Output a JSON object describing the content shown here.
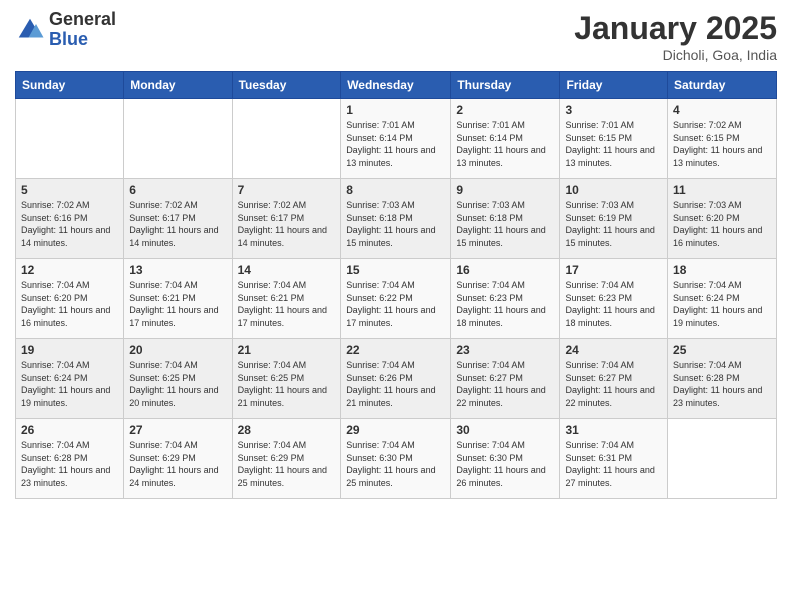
{
  "logo": {
    "general": "General",
    "blue": "Blue"
  },
  "title": "January 2025",
  "subtitle": "Dicholi, Goa, India",
  "weekdays": [
    "Sunday",
    "Monday",
    "Tuesday",
    "Wednesday",
    "Thursday",
    "Friday",
    "Saturday"
  ],
  "weeks": [
    [
      {
        "day": "",
        "sunrise": "",
        "sunset": "",
        "daylight": ""
      },
      {
        "day": "",
        "sunrise": "",
        "sunset": "",
        "daylight": ""
      },
      {
        "day": "",
        "sunrise": "",
        "sunset": "",
        "daylight": ""
      },
      {
        "day": "1",
        "sunrise": "Sunrise: 7:01 AM",
        "sunset": "Sunset: 6:14 PM",
        "daylight": "Daylight: 11 hours and 13 minutes."
      },
      {
        "day": "2",
        "sunrise": "Sunrise: 7:01 AM",
        "sunset": "Sunset: 6:14 PM",
        "daylight": "Daylight: 11 hours and 13 minutes."
      },
      {
        "day": "3",
        "sunrise": "Sunrise: 7:01 AM",
        "sunset": "Sunset: 6:15 PM",
        "daylight": "Daylight: 11 hours and 13 minutes."
      },
      {
        "day": "4",
        "sunrise": "Sunrise: 7:02 AM",
        "sunset": "Sunset: 6:15 PM",
        "daylight": "Daylight: 11 hours and 13 minutes."
      }
    ],
    [
      {
        "day": "5",
        "sunrise": "Sunrise: 7:02 AM",
        "sunset": "Sunset: 6:16 PM",
        "daylight": "Daylight: 11 hours and 14 minutes."
      },
      {
        "day": "6",
        "sunrise": "Sunrise: 7:02 AM",
        "sunset": "Sunset: 6:17 PM",
        "daylight": "Daylight: 11 hours and 14 minutes."
      },
      {
        "day": "7",
        "sunrise": "Sunrise: 7:02 AM",
        "sunset": "Sunset: 6:17 PM",
        "daylight": "Daylight: 11 hours and 14 minutes."
      },
      {
        "day": "8",
        "sunrise": "Sunrise: 7:03 AM",
        "sunset": "Sunset: 6:18 PM",
        "daylight": "Daylight: 11 hours and 15 minutes."
      },
      {
        "day": "9",
        "sunrise": "Sunrise: 7:03 AM",
        "sunset": "Sunset: 6:18 PM",
        "daylight": "Daylight: 11 hours and 15 minutes."
      },
      {
        "day": "10",
        "sunrise": "Sunrise: 7:03 AM",
        "sunset": "Sunset: 6:19 PM",
        "daylight": "Daylight: 11 hours and 15 minutes."
      },
      {
        "day": "11",
        "sunrise": "Sunrise: 7:03 AM",
        "sunset": "Sunset: 6:20 PM",
        "daylight": "Daylight: 11 hours and 16 minutes."
      }
    ],
    [
      {
        "day": "12",
        "sunrise": "Sunrise: 7:04 AM",
        "sunset": "Sunset: 6:20 PM",
        "daylight": "Daylight: 11 hours and 16 minutes."
      },
      {
        "day": "13",
        "sunrise": "Sunrise: 7:04 AM",
        "sunset": "Sunset: 6:21 PM",
        "daylight": "Daylight: 11 hours and 17 minutes."
      },
      {
        "day": "14",
        "sunrise": "Sunrise: 7:04 AM",
        "sunset": "Sunset: 6:21 PM",
        "daylight": "Daylight: 11 hours and 17 minutes."
      },
      {
        "day": "15",
        "sunrise": "Sunrise: 7:04 AM",
        "sunset": "Sunset: 6:22 PM",
        "daylight": "Daylight: 11 hours and 17 minutes."
      },
      {
        "day": "16",
        "sunrise": "Sunrise: 7:04 AM",
        "sunset": "Sunset: 6:23 PM",
        "daylight": "Daylight: 11 hours and 18 minutes."
      },
      {
        "day": "17",
        "sunrise": "Sunrise: 7:04 AM",
        "sunset": "Sunset: 6:23 PM",
        "daylight": "Daylight: 11 hours and 18 minutes."
      },
      {
        "day": "18",
        "sunrise": "Sunrise: 7:04 AM",
        "sunset": "Sunset: 6:24 PM",
        "daylight": "Daylight: 11 hours and 19 minutes."
      }
    ],
    [
      {
        "day": "19",
        "sunrise": "Sunrise: 7:04 AM",
        "sunset": "Sunset: 6:24 PM",
        "daylight": "Daylight: 11 hours and 19 minutes."
      },
      {
        "day": "20",
        "sunrise": "Sunrise: 7:04 AM",
        "sunset": "Sunset: 6:25 PM",
        "daylight": "Daylight: 11 hours and 20 minutes."
      },
      {
        "day": "21",
        "sunrise": "Sunrise: 7:04 AM",
        "sunset": "Sunset: 6:25 PM",
        "daylight": "Daylight: 11 hours and 21 minutes."
      },
      {
        "day": "22",
        "sunrise": "Sunrise: 7:04 AM",
        "sunset": "Sunset: 6:26 PM",
        "daylight": "Daylight: 11 hours and 21 minutes."
      },
      {
        "day": "23",
        "sunrise": "Sunrise: 7:04 AM",
        "sunset": "Sunset: 6:27 PM",
        "daylight": "Daylight: 11 hours and 22 minutes."
      },
      {
        "day": "24",
        "sunrise": "Sunrise: 7:04 AM",
        "sunset": "Sunset: 6:27 PM",
        "daylight": "Daylight: 11 hours and 22 minutes."
      },
      {
        "day": "25",
        "sunrise": "Sunrise: 7:04 AM",
        "sunset": "Sunset: 6:28 PM",
        "daylight": "Daylight: 11 hours and 23 minutes."
      }
    ],
    [
      {
        "day": "26",
        "sunrise": "Sunrise: 7:04 AM",
        "sunset": "Sunset: 6:28 PM",
        "daylight": "Daylight: 11 hours and 23 minutes."
      },
      {
        "day": "27",
        "sunrise": "Sunrise: 7:04 AM",
        "sunset": "Sunset: 6:29 PM",
        "daylight": "Daylight: 11 hours and 24 minutes."
      },
      {
        "day": "28",
        "sunrise": "Sunrise: 7:04 AM",
        "sunset": "Sunset: 6:29 PM",
        "daylight": "Daylight: 11 hours and 25 minutes."
      },
      {
        "day": "29",
        "sunrise": "Sunrise: 7:04 AM",
        "sunset": "Sunset: 6:30 PM",
        "daylight": "Daylight: 11 hours and 25 minutes."
      },
      {
        "day": "30",
        "sunrise": "Sunrise: 7:04 AM",
        "sunset": "Sunset: 6:30 PM",
        "daylight": "Daylight: 11 hours and 26 minutes."
      },
      {
        "day": "31",
        "sunrise": "Sunrise: 7:04 AM",
        "sunset": "Sunset: 6:31 PM",
        "daylight": "Daylight: 11 hours and 27 minutes."
      },
      {
        "day": "",
        "sunrise": "",
        "sunset": "",
        "daylight": ""
      }
    ]
  ]
}
